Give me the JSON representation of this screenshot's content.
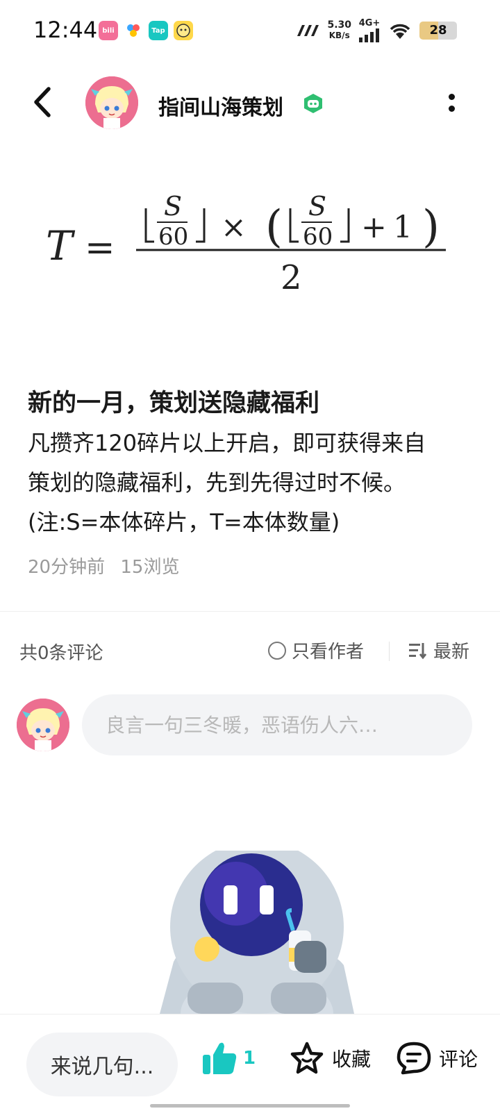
{
  "status_bar": {
    "time": "12:44",
    "apps": [
      "bilibili",
      "app2",
      "Tap",
      "app4"
    ],
    "net_speed_value": "5.30",
    "net_speed_unit": "KB/s",
    "network": "4G+",
    "battery": "28"
  },
  "header": {
    "author_name": "指间山海策划"
  },
  "post": {
    "title": "新的一月，策划送隐藏福利",
    "body_lines": [
      "凡攒齐120碎片以上开启，即可获得来自",
      "策划的隐藏福利，先到先得过时不候。",
      "(注:S=本体碎片，T=本体数量)"
    ],
    "time_ago": "20分钟前",
    "views": "15浏览"
  },
  "comments": {
    "count_label": "共0条评论",
    "only_author_label": "只看作者",
    "sort_label": "最新",
    "input_placeholder": "良言一句三冬暖，恶语伤人六…"
  },
  "bottom_bar": {
    "say_label": "来说几句...",
    "like_count": "1",
    "favorite_label": "收藏",
    "comment_label": "评论"
  },
  "colors": {
    "accent": "#19c7c1",
    "verify_green": "#2fbf71"
  }
}
